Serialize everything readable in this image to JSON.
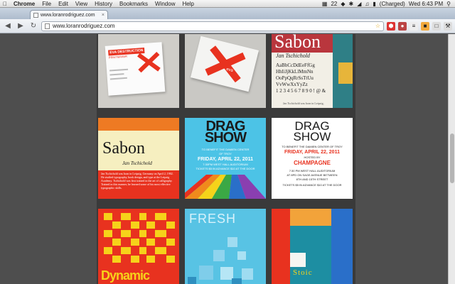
{
  "menubar": {
    "items": [
      "Chrome",
      "File",
      "Edit",
      "View",
      "History",
      "Bookmarks",
      "Window",
      "Help"
    ],
    "status": {
      "badge": "22",
      "battery": "(Charged)",
      "clock": "Wed 6:43 PM"
    }
  },
  "tab": {
    "title": "www.loranrodriguez.com"
  },
  "toolbar": {
    "url": "www.loranrodriguez.com"
  },
  "tiles": {
    "card_front": {
      "name": "EVA DESTRUCTION",
      "role": "PRINTMAKER"
    },
    "card_back": {
      "logo": "eva"
    },
    "sabon_specimen": {
      "title": "Sabon",
      "author": "Jan Tschichold",
      "upper": "AaBbCcDdEeFfGg",
      "upper2": "HhIiJjKkLlMmNn",
      "upper3": "OoPpQqRrSsTtUu",
      "upper4": "VvWwXxYyZz",
      "digits": "1 2 3 4 5 6 7 8 9 0 ! @ &",
      "caption": "Jan Tschichold was born in Leipzig,"
    },
    "sabon_poster": {
      "title": "Sabon",
      "author": "Jan Tschichold",
      "body": "Jan Tschichold was born in Leipzig, Germany on April 2, 1902. He studied typography, book design, and type at the Leipzig Academy. Tschichold was first trained in the art of calligraphy. Trained in this manner, he learned some of his most effective typographic skills."
    },
    "drag_blue": {
      "title1": "DRAG",
      "title2": "SHOW",
      "line1": "TO BENEFIT THE DAMIEN CENTER",
      "line2": "OF TROY",
      "date": "FRIDAY, APRIL 22, 2011",
      "line3": "7:30PM WEST HALL AUDITORIUM",
      "line4": "TICKETS $5 IN ADVANCE $10 AT THE DOOR"
    },
    "drag_white": {
      "title1": "DRAG",
      "title2": "SHOW",
      "line1": "TO BENEFIT THE DAMIEN CENTER OF TROY",
      "date": "FRIDAY, APRIL 22, 2011",
      "hosted": "HOSTED BY",
      "host": "CHAMPAGNE",
      "venue1": "7:30 PM WEST HALL AUDITORIUM",
      "venue2": "AT 8PD ON SAGE AVENUE BETWEEN",
      "venue3": "8TH AND 15TH STREET",
      "tickets": "TICKETS $5 IN ADVANCE $10 AT THE DOOR"
    },
    "dynamic": {
      "title": "Dynamic"
    },
    "fresh": {
      "title": "FRESH"
    },
    "stoic": {
      "title": "Stoic"
    }
  },
  "colors": {
    "accent_red": "#e8321f",
    "drag_blue": "#4cc3e6",
    "fresh_blue": "#58c3e4",
    "sabon_cream": "#f6efc0",
    "stoic_teal": "#1d8ea2"
  }
}
